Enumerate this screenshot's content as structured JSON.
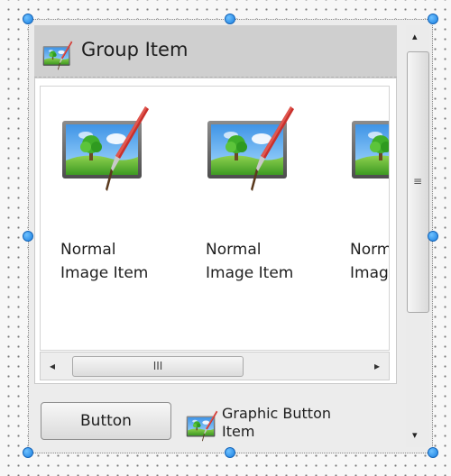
{
  "group_item": {
    "title": "Group Item",
    "icon": "image-edit-icon"
  },
  "image_items": [
    {
      "label_line1": "Normal",
      "label_line2": "Image Item",
      "icon": "image-edit-icon"
    },
    {
      "label_line1": "Normal",
      "label_line2": "Image Item",
      "icon": "image-edit-icon"
    },
    {
      "label_line1": "Normal",
      "label_line2": "Image Item",
      "icon": "image-edit-icon"
    }
  ],
  "horizontal_scrollbar": {
    "left_arrow": "◂",
    "right_arrow": "▸",
    "grip": "III"
  },
  "vertical_scrollbar": {
    "up_arrow": "▴",
    "down_arrow": "▾",
    "grip": "≡"
  },
  "push_button": {
    "label": "Button"
  },
  "graphic_button": {
    "label_line1": "Graphic Button",
    "label_line2": "Item",
    "icon": "image-edit-icon"
  },
  "colors": {
    "handle": "#1a7fe0",
    "header_bg": "#cfcfcf",
    "panel_bg": "#ffffff",
    "frame_bg": "#ececec"
  }
}
